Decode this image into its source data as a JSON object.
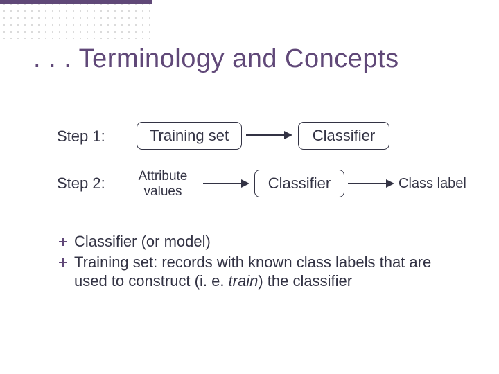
{
  "title": ". . . Terminology and Concepts",
  "step1": {
    "label": "Step 1:",
    "box_training": "Training set",
    "box_classifier": "Classifier"
  },
  "step2": {
    "label": "Step 2:",
    "attribute_line1": "Attribute",
    "attribute_line2": "values",
    "box_classifier": "Classifier",
    "class_label": "Class label"
  },
  "bullets": {
    "b1": "Classifier (or model)",
    "b2_part1": "Training set: records with known class labels that are used to construct (i. e. ",
    "b2_italic": "train",
    "b2_part2": ") the classifier"
  }
}
